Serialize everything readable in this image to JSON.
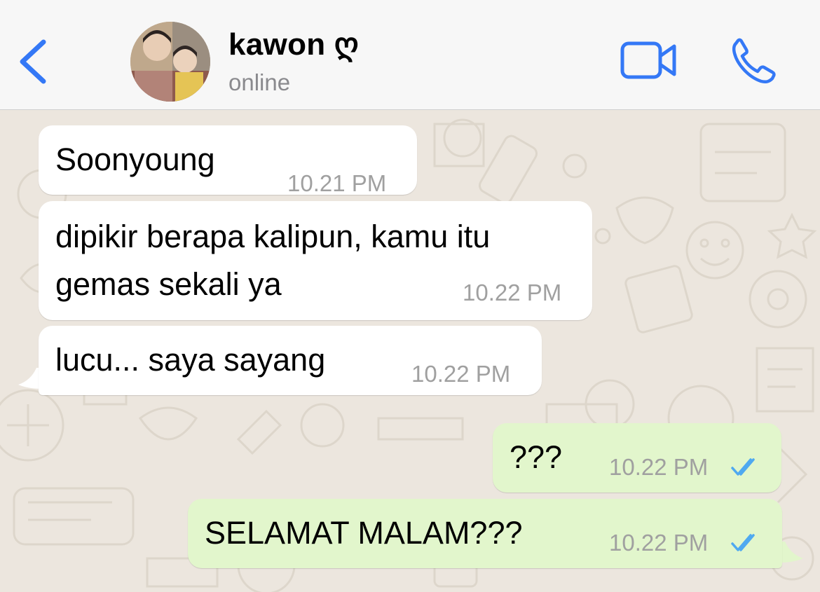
{
  "header": {
    "contact_name": "kawon ღ",
    "status": "online",
    "icons": {
      "back": "chevron-left-icon",
      "video": "video-camera-icon",
      "call": "phone-icon"
    }
  },
  "colors": {
    "accent": "#3478F6",
    "incoming_bubble": "#FFFFFF",
    "outgoing_bubble": "#E2F6CC",
    "chat_background": "#ECE6DE",
    "read_ticks": "#4FA9F0",
    "timestamp": "#A0A0A0"
  },
  "messages": [
    {
      "direction": "incoming",
      "lines": [
        "Soonyoung"
      ],
      "time": "10.21 PM"
    },
    {
      "direction": "incoming",
      "lines": [
        "dipikir berapa kalipun, kamu itu",
        "gemas sekali ya"
      ],
      "time": "10.22 PM"
    },
    {
      "direction": "incoming",
      "lines": [
        "lucu... saya sayang"
      ],
      "time": "10.22 PM"
    },
    {
      "direction": "outgoing",
      "lines": [
        "???"
      ],
      "time": "10.22 PM",
      "status": "read"
    },
    {
      "direction": "outgoing",
      "lines": [
        "SELAMAT MALAM???"
      ],
      "time": "10.22 PM",
      "status": "read"
    }
  ]
}
